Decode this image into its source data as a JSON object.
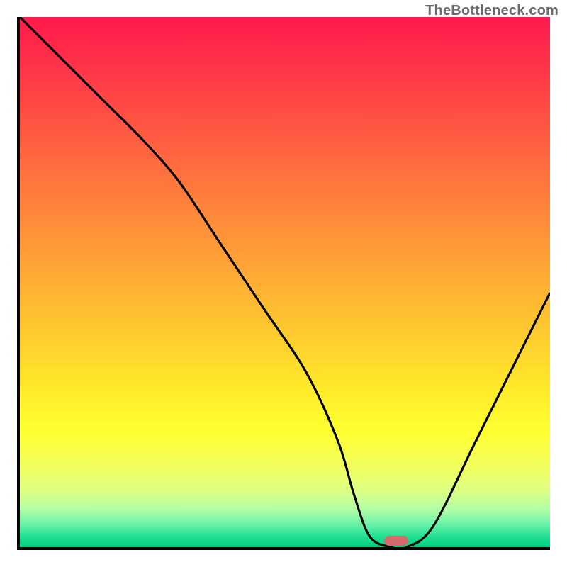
{
  "watermark": "TheBottleneck.com",
  "chart_data": {
    "type": "line",
    "title": "",
    "xlabel": "",
    "ylabel": "",
    "x_range": [
      0,
      100
    ],
    "y_range": [
      0,
      100
    ],
    "grid": false,
    "legend": false,
    "background": "smooth vertical gradient (red→orange→yellow→green bottom)",
    "series": [
      {
        "name": "bottleneck-curve",
        "x": [
          0,
          8,
          16,
          23,
          30,
          38,
          46,
          54,
          60,
          63,
          66,
          70,
          73,
          78,
          86,
          94,
          100
        ],
        "values": [
          100,
          92,
          84,
          77,
          69,
          57,
          45,
          33,
          20,
          10,
          2,
          0,
          0,
          4,
          20,
          36,
          48
        ]
      }
    ],
    "marker": {
      "x": 71,
      "y": 1.2,
      "shape": "pill",
      "color": "#d46a6a"
    },
    "annotations": []
  }
}
